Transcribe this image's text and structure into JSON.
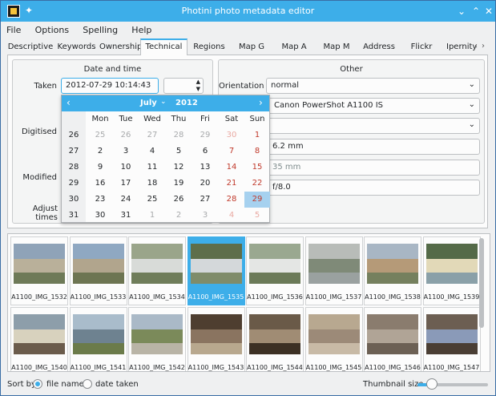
{
  "window": {
    "title": "Photini photo metadata editor"
  },
  "menu": [
    "File",
    "Options",
    "Spelling",
    "Help"
  ],
  "tabs": [
    "Descriptive",
    "Keywords",
    "Ownership",
    "Technical",
    "Regions",
    "Map G",
    "Map A",
    "Map M",
    "Address",
    "Flickr",
    "Ipernity"
  ],
  "active_tab": "Technical",
  "date_time": {
    "group_title": "Date and time",
    "taken_label": "Taken",
    "taken_value": "2012-07-29 10:14:43",
    "digitised_label": "Digitised",
    "modified_label": "Modified",
    "adjust_label": "Adjust times"
  },
  "other": {
    "group_title": "Other",
    "orientation_label": "Orientation",
    "orientation_value": "normal",
    "camera_value": "Canon PowerShot A1100 IS",
    "focal_length_value": "6.2 mm",
    "focal_35_value": "35 mm",
    "aperture_value": "f/8.0"
  },
  "calendar": {
    "month": "July",
    "year": "2012",
    "prev_glyph": "‹",
    "next_glyph": "›",
    "chevron": "⌄",
    "weekdays": [
      "Mon",
      "Tue",
      "Wed",
      "Thu",
      "Fri",
      "Sat",
      "Sun"
    ],
    "weeks": [
      "26",
      "27",
      "28",
      "29",
      "30",
      "31"
    ],
    "days": [
      [
        "25",
        "26",
        "27",
        "28",
        "29",
        "30",
        "1"
      ],
      [
        "2",
        "3",
        "4",
        "5",
        "6",
        "7",
        "8"
      ],
      [
        "9",
        "10",
        "11",
        "12",
        "13",
        "14",
        "15"
      ],
      [
        "16",
        "17",
        "18",
        "19",
        "20",
        "21",
        "22"
      ],
      [
        "23",
        "24",
        "25",
        "26",
        "27",
        "28",
        "29"
      ],
      [
        "30",
        "31",
        "1",
        "2",
        "3",
        "4",
        "5"
      ]
    ],
    "dim_rows": {
      "0": [
        0,
        1,
        2,
        3,
        4,
        5
      ],
      "5": [
        2,
        3,
        4,
        5,
        6
      ]
    },
    "selected": [
      4,
      6
    ]
  },
  "thumbnails": [
    "A1100_IMG_1532",
    "A1100_IMG_1533",
    "A1100_IMG_1534",
    "A1100_IMG_1535",
    "A1100_IMG_1536",
    "A1100_IMG_1537",
    "A1100_IMG_1538",
    "A1100_IMG_1539",
    "A1100_IMG_1540",
    "A1100_IMG_1541",
    "A1100_IMG_1542",
    "A1100_IMG_1543",
    "A1100_IMG_1544",
    "A1100_IMG_1545",
    "A1100_IMG_1546",
    "A1100_IMG_1547"
  ],
  "selected_thumbnail": "A1100_IMG_1535",
  "status": {
    "sort_label": "Sort by",
    "sort_file_name": "file name",
    "sort_date_taken": "date taken",
    "thumb_size_label": "Thumbnail size",
    "thumb_size_level": 0.2
  },
  "colors": {
    "accent": "#3daee9",
    "weekend": "#c0392b",
    "selected_day": "#a6d1ef"
  },
  "icons": {
    "window": [
      "app-icon",
      "pin-icon",
      "minimize-icon",
      "maximize-icon",
      "close-icon"
    ],
    "tab_scroll": [
      "chevron-left-icon",
      "chevron-right-icon"
    ],
    "combo_glyph": "⌄",
    "spin_up": "▲",
    "spin_down": "▼",
    "close_glyph": "✕",
    "minimize_glyph": "⌄",
    "maximize_glyph": "⌃",
    "pin_glyph": "✦",
    "tab_left_glyph": "‹",
    "tab_right_glyph": "›"
  }
}
